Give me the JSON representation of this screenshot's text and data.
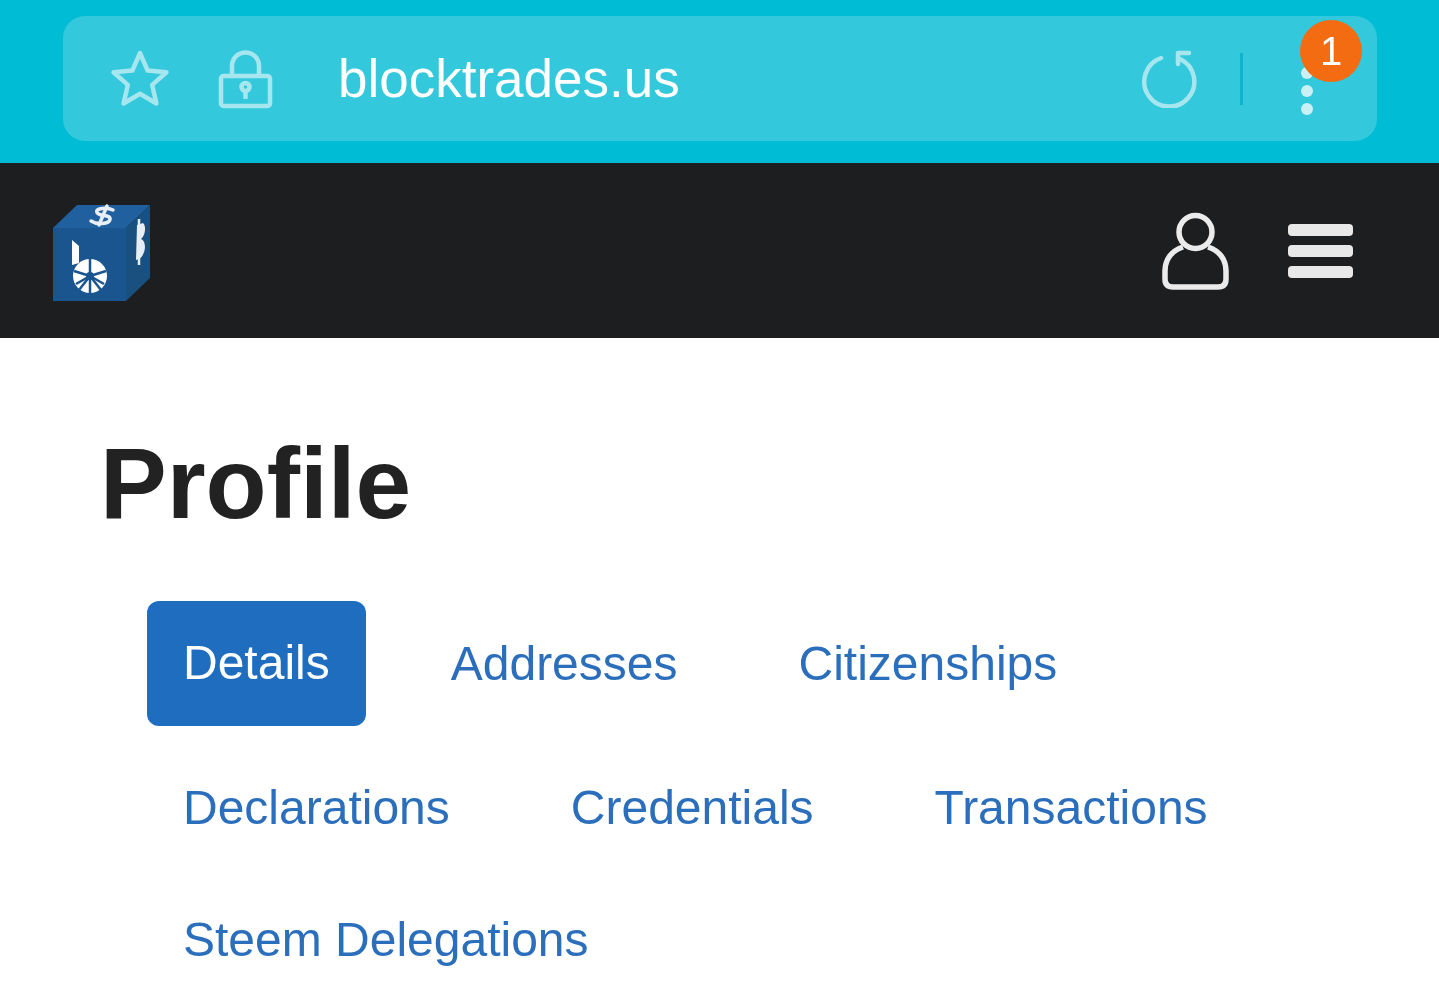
{
  "browser": {
    "url": "blocktrades.us",
    "menu_badge": "1"
  },
  "page": {
    "title": "Profile"
  },
  "tabs": [
    {
      "label": "Details",
      "selected": true
    },
    {
      "label": "Addresses",
      "selected": false
    },
    {
      "label": "Citizenships",
      "selected": false
    },
    {
      "label": "Declarations",
      "selected": false
    },
    {
      "label": "Credentials",
      "selected": false
    },
    {
      "label": "Transactions",
      "selected": false
    },
    {
      "label": "Steem Delegations",
      "selected": false
    }
  ]
}
